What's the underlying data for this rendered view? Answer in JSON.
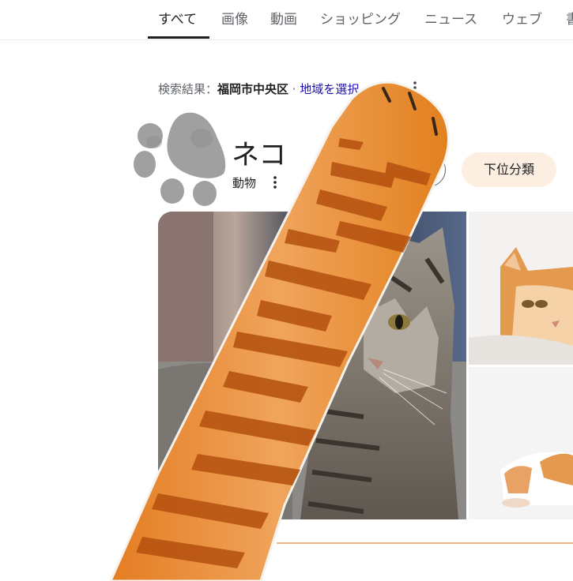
{
  "tabs": [
    {
      "label": "すべて",
      "active": true
    },
    {
      "label": "画像"
    },
    {
      "label": "動画"
    },
    {
      "label": "ショッピング"
    },
    {
      "label": "ニュース"
    },
    {
      "label": "ウェブ"
    },
    {
      "label": "書"
    }
  ],
  "location": {
    "prefix": "検索結果：",
    "place": "福岡市中央区",
    "separator": " · ",
    "select_link": "地域を選択"
  },
  "entity": {
    "title": "ネコ",
    "subtitle": "動物"
  },
  "chips": [
    {
      "label": ""
    },
    {
      "label": "下位分類"
    }
  ],
  "images": [
    {
      "name": "tabby-cat-photo",
      "icon": "cat-photo"
    },
    {
      "name": "orange-cat-photo",
      "icon": "cat-photo"
    },
    {
      "name": "white-orange-cat-photo",
      "icon": "cat-photo"
    }
  ],
  "colors": {
    "tab_underline": "#1f1f1f",
    "link": "#1a0dab",
    "chip_bg": "#fdeee2",
    "cat_arm": "#e88a32",
    "stripe": "#b4500f",
    "paw_print": "#a0a0a0",
    "accent_line": "#f0b67c"
  }
}
